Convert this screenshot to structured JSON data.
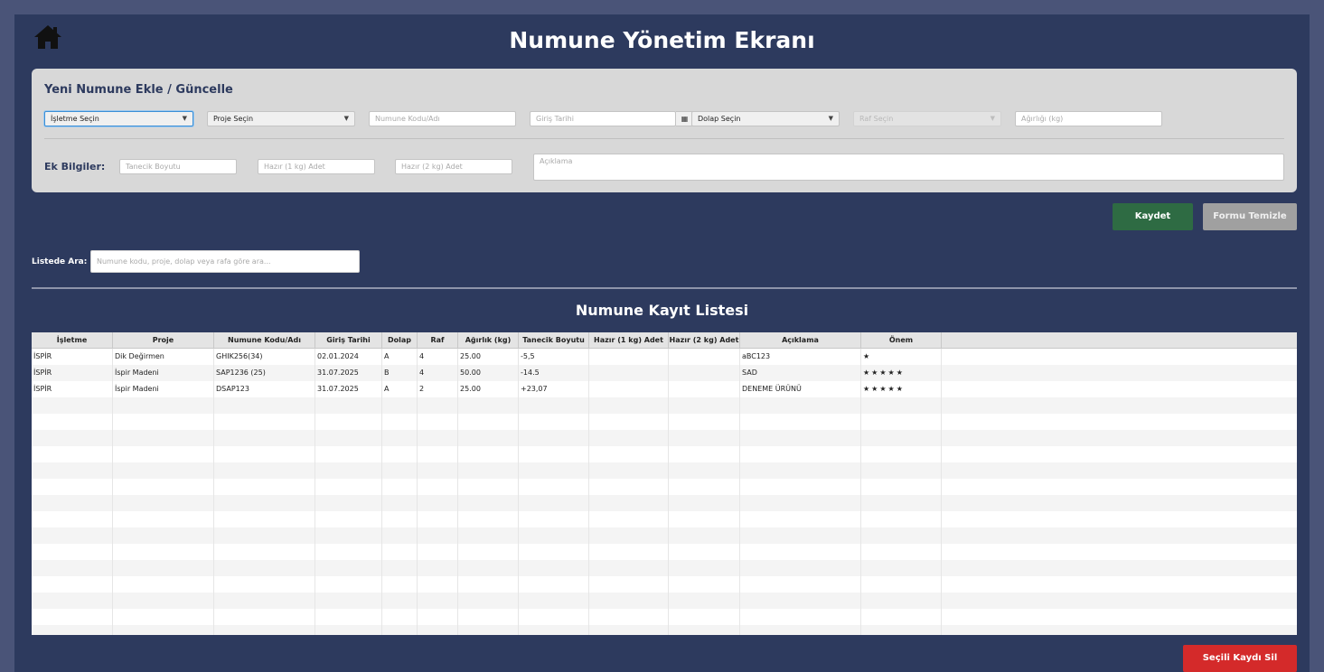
{
  "header": {
    "title": "Numune Yönetim Ekranı",
    "home_icon": "home-icon"
  },
  "form": {
    "title": "Yeni Numune Ekle / Güncelle",
    "isletme_select": "İşletme Seçin",
    "proje_select": "Proje Seçin",
    "numune_kodu_placeholder": "Numune Kodu/Adı",
    "giris_tarihi_placeholder": "Giriş Tarihi",
    "dolap_select": "Dolap Seçin",
    "raf_select": "Raf Seçin",
    "agirlik_placeholder": "Ağırlığı (kg)",
    "extra_label": "Ek Bilgiler:",
    "tanecik_placeholder": "Tanecik Boyutu",
    "hazir1_placeholder": "Hazır (1 kg) Adet",
    "hazir2_placeholder": "Hazır (2 kg) Adet",
    "aciklama_placeholder": "Açıklama"
  },
  "actions": {
    "save": "Kaydet",
    "clear": "Formu Temizle",
    "delete": "Seçili Kaydı Sil"
  },
  "search": {
    "label": "Listede Ara:",
    "placeholder": "Numune kodu, proje, dolap veya rafa göre ara..."
  },
  "list": {
    "title": "Numune Kayıt Listesi",
    "columns": [
      "İşletme",
      "Proje",
      "Numune Kodu/Adı",
      "Giriş Tarihi",
      "Dolap",
      "Raf",
      "Ağırlık (kg)",
      "Tanecik Boyutu",
      "Hazır (1 kg) Adet",
      "Hazır (2 kg) Adet",
      "Açıklama",
      "Önem"
    ],
    "rows": [
      [
        "İSPİR",
        "Dik Değirmen",
        "GHIK256(34)",
        "02.01.2024",
        "A",
        "4",
        "25.00",
        "-5,5",
        "",
        "",
        "aBC123",
        "★"
      ],
      [
        "İSPİR",
        "İspir Madeni",
        "SAP1236 (25)",
        "31.07.2025",
        "B",
        "4",
        "50.00",
        "-14.5",
        "",
        "",
        "SAD",
        "★★★★★"
      ],
      [
        "İSPİR",
        "İspir Madeni",
        "DSAP123",
        "31.07.2025",
        "A",
        "2",
        "25.00",
        "+23,07",
        "",
        "",
        "DENEME ÜRÜNÜ",
        "★★★★★"
      ]
    ]
  },
  "colors": {
    "background": "#4a5478",
    "panel": "#2d3a5e",
    "save": "#2e6b43",
    "clear": "#a0a0a0",
    "delete": "#d42a2a"
  }
}
